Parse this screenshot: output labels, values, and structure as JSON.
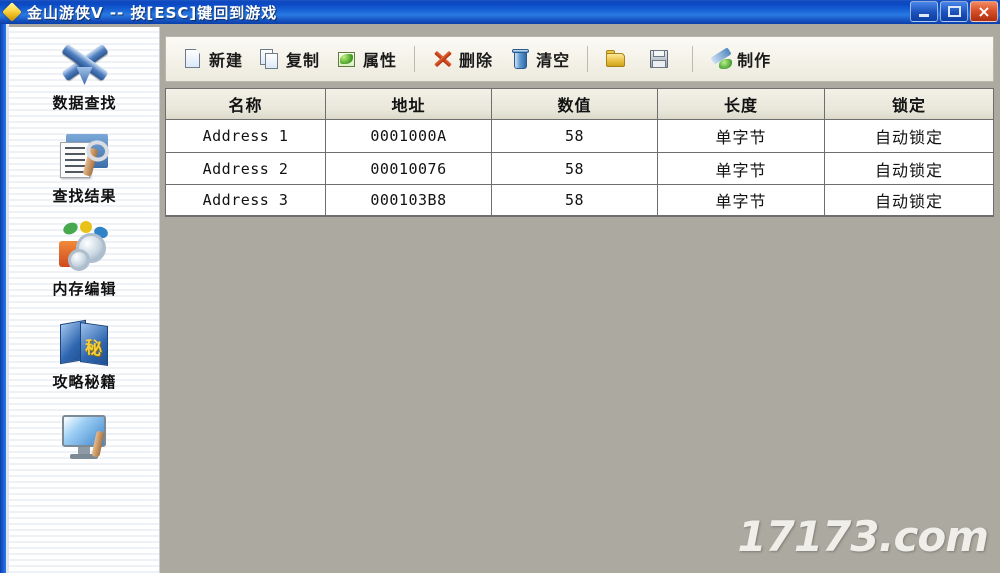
{
  "window": {
    "title": "金山游侠V -- 按[ESC]键回到游戏",
    "app_icon": "gold-diamond-logo-icon",
    "controls": {
      "minimize": "minimize-icon",
      "maximize": "restore-icon",
      "close": "×"
    },
    "titlebar_color": "#1a5ed0",
    "close_color": "#d9512a",
    "background_color": "#aca9a0"
  },
  "sidebar": {
    "items": [
      {
        "label": "数据查找",
        "icon": "crossed-tools-icon"
      },
      {
        "label": "查找结果",
        "icon": "document-wrench-icon"
      },
      {
        "label": "内存编辑",
        "icon": "gears-blocks-icon"
      },
      {
        "label": "攻略秘籍",
        "icon": "books-secret-icon"
      },
      {
        "label": "",
        "icon": "monitor-wrench-icon"
      }
    ]
  },
  "toolbar": {
    "buttons": [
      {
        "label": "新建",
        "icon": "new-page-icon"
      },
      {
        "label": "复制",
        "icon": "copy-pages-icon"
      },
      {
        "label": "属性",
        "icon": "properties-leaf-icon"
      },
      {
        "label": "删除",
        "icon": "delete-x-icon"
      },
      {
        "label": "清空",
        "icon": "trash-can-icon"
      },
      {
        "label": "",
        "icon": "open-folder-icon"
      },
      {
        "label": "",
        "icon": "save-floppy-icon"
      },
      {
        "label": "制作",
        "icon": "make-brush-icon"
      }
    ]
  },
  "table": {
    "columns": [
      "名称",
      "地址",
      "数值",
      "长度",
      "锁定"
    ],
    "rows": [
      {
        "name": "Address 1",
        "address": "0001000A",
        "value": "58",
        "length": "单字节",
        "lock": "自动锁定"
      },
      {
        "name": "Address 2",
        "address": "00010076",
        "value": "58",
        "length": "单字节",
        "lock": "自动锁定"
      },
      {
        "name": "Address 3",
        "address": "000103B8",
        "value": "58",
        "length": "单字节",
        "lock": "自动锁定"
      }
    ]
  },
  "watermark": {
    "text": "17173.com"
  }
}
